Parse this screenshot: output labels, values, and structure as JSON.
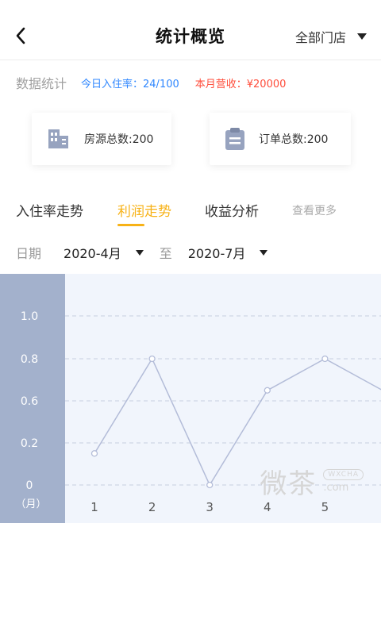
{
  "header": {
    "title": "统计概览",
    "store_selector": "全部门店"
  },
  "stats": {
    "label": "数据统计",
    "occupancy": "今日入住率：24/100",
    "revenue": "本月营收：¥20000",
    "occupancy_color": "#2f87ff",
    "revenue_color": "#ff4d3b"
  },
  "cards": [
    {
      "icon": "building-icon",
      "text": "房源总数:200"
    },
    {
      "icon": "clipboard-icon",
      "text": "订单总数:200"
    }
  ],
  "tabs": {
    "items": [
      "入住率走势",
      "利润走势",
      "收益分析"
    ],
    "active_index": 1,
    "active_color": "#f7b217",
    "more": "查看更多"
  },
  "date_filter": {
    "label": "日期",
    "start": "2020-4月",
    "separator": "至",
    "end": "2020-7月"
  },
  "chart_data": {
    "type": "line",
    "x": [
      1,
      2,
      3,
      4,
      5,
      6
    ],
    "x_tick_labels": [
      "1",
      "2",
      "3",
      "4",
      "5"
    ],
    "values": [
      0.2,
      0.8,
      0,
      0.6,
      0.8,
      0.6
    ],
    "y_tick_labels": [
      "1.0",
      "0.8",
      "0.6",
      "0.2",
      "0"
    ],
    "xlabel": "（月）",
    "grid": true,
    "line_color": "#b3bcd8"
  },
  "watermark": {
    "main": "微茶",
    "badge": "WXCHA",
    "domain": ".com"
  }
}
